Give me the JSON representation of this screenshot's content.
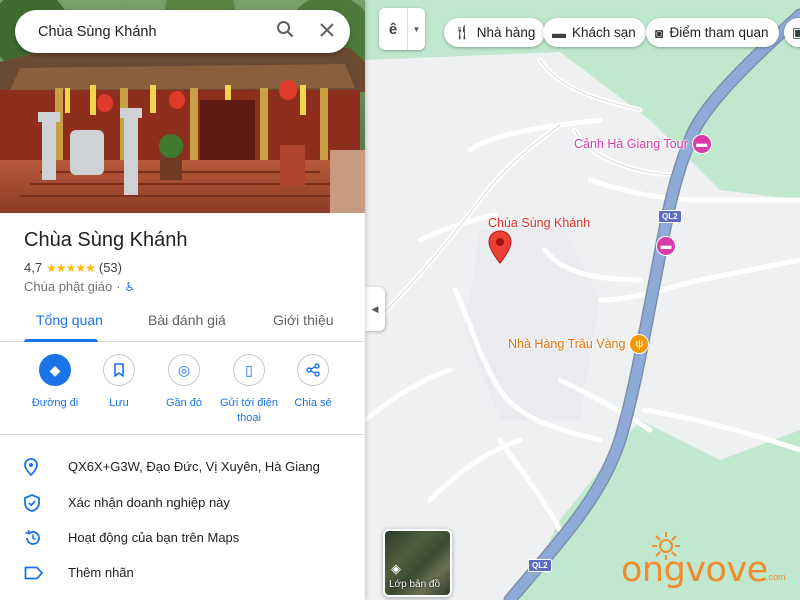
{
  "search": {
    "query": "Chùa Sùng Khánh"
  },
  "place": {
    "name": "Chùa Sùng Khánh",
    "rating": "4,7",
    "stars": "★★★★★",
    "review_count": "(53)",
    "category": "Chùa phật giáo",
    "separator": "·"
  },
  "tabs": [
    {
      "label": "Tổng quan"
    },
    {
      "label": "Bài đánh giá"
    },
    {
      "label": "Giới thiệu"
    }
  ],
  "actions": [
    {
      "label": "Đường đi"
    },
    {
      "label": "Lưu"
    },
    {
      "label": "Gần đó"
    },
    {
      "label": "Gửi tới điện thoại"
    },
    {
      "label": "Chia sẻ"
    }
  ],
  "info_rows": [
    {
      "text": "QX6X+G3W, Đạo Đức, Vị Xuyên, Hà Giang",
      "icon": "location-pin-icon"
    },
    {
      "text": "Xác nhận doanh nghiệp này",
      "icon": "verified-shield-icon"
    },
    {
      "text": "Hoạt động của bạn trên Maps",
      "icon": "history-icon"
    },
    {
      "text": "Thêm nhãn",
      "icon": "label-icon"
    }
  ],
  "map": {
    "lang_glyph": "ê",
    "chips": [
      {
        "label": "Nhà hàng",
        "icon": "fork-knife-icon"
      },
      {
        "label": "Khách sạn",
        "icon": "bed-icon"
      },
      {
        "label": "Điểm tham quan",
        "icon": "camera-icon"
      }
    ],
    "pois": [
      {
        "label": "Cảnh Hà Giang Tour",
        "color": "#d93ba8"
      },
      {
        "label": "Chùa Sùng Khánh",
        "color": "#d93025"
      },
      {
        "label": "Nhà Hàng Trâu Vàng",
        "color": "#e8710a"
      }
    ],
    "road_shields": [
      "QL2",
      "QL2"
    ],
    "layers_label": "Lớp bản đồ",
    "watermark": {
      "text": "ongvove",
      "domain": ".com"
    }
  },
  "colors": {
    "accent": "#1a73e8",
    "map_green": "#bfe8cf",
    "road_blue": "#8aa6d4",
    "hotel_pink": "#d93ba8",
    "restaurant_orange": "#e8710a",
    "pin_red": "#d93025"
  }
}
